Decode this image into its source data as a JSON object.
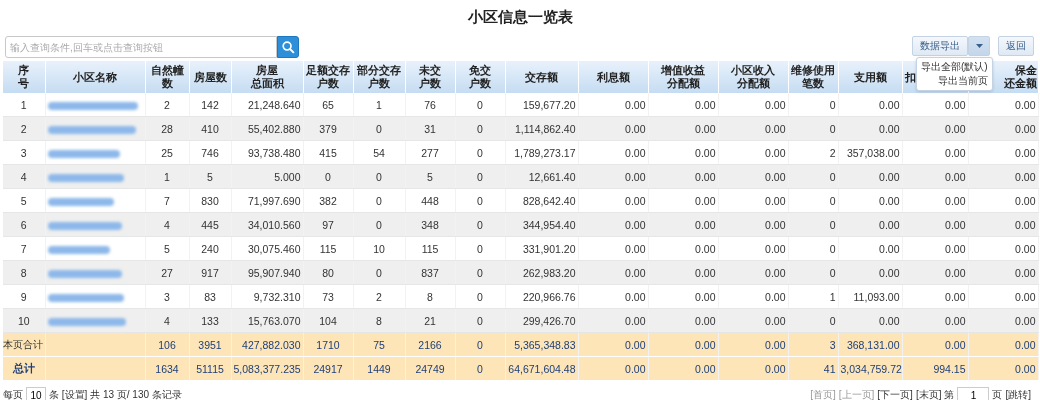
{
  "title": "小区信息一览表",
  "search": {
    "placeholder": "输入查询条件,回车或点击查询按钮"
  },
  "toolbar": {
    "export_button": "数据导出",
    "back_button": "返回"
  },
  "export_menu": {
    "expanded": true,
    "items": [
      "导出全部(默认)",
      "导出当前页"
    ]
  },
  "columns": [
    {
      "lines": [
        "序",
        "号"
      ]
    },
    {
      "lines": [
        "小区名称"
      ]
    },
    {
      "lines": [
        "自然幢",
        "数"
      ]
    },
    {
      "lines": [
        "房屋数"
      ]
    },
    {
      "lines": [
        "房屋",
        "总面积"
      ]
    },
    {
      "lines": [
        "足额交存",
        "户数"
      ]
    },
    {
      "lines": [
        "部分交存",
        "户数"
      ]
    },
    {
      "lines": [
        "未交",
        "户数"
      ]
    },
    {
      "lines": [
        "免交",
        "户数"
      ]
    },
    {
      "lines": [
        "交存额"
      ]
    },
    {
      "lines": [
        "利息额"
      ]
    },
    {
      "lines": [
        "增值收益",
        "分配额"
      ]
    },
    {
      "lines": [
        "小区收入",
        "分配额"
      ]
    },
    {
      "lines": [
        "维修使用",
        "笔数"
      ]
    },
    {
      "lines": [
        "支用额"
      ]
    },
    {
      "lines": [
        "扣"
      ]
    },
    {
      "lines": [
        "保金",
        "还金额"
      ]
    }
  ],
  "rows": [
    {
      "no": "1",
      "cells": [
        "2",
        "142",
        "21,248.640",
        "65",
        "1",
        "76",
        "0",
        "159,677.20",
        "0.00",
        "0.00",
        "0.00",
        "0",
        "0.00",
        "0.00",
        "0.00"
      ]
    },
    {
      "no": "2",
      "cells": [
        "28",
        "410",
        "55,402.880",
        "379",
        "0",
        "31",
        "0",
        "1,114,862.40",
        "0.00",
        "0.00",
        "0.00",
        "0",
        "0.00",
        "0.00",
        "0.00"
      ]
    },
    {
      "no": "3",
      "cells": [
        "25",
        "746",
        "93,738.480",
        "415",
        "54",
        "277",
        "0",
        "1,789,273.17",
        "0.00",
        "0.00",
        "0.00",
        "2",
        "357,038.00",
        "0.00",
        "0.00"
      ]
    },
    {
      "no": "4",
      "cells": [
        "1",
        "5",
        "5.000",
        "0",
        "0",
        "5",
        "0",
        "12,661.40",
        "0.00",
        "0.00",
        "0.00",
        "0",
        "0.00",
        "0.00",
        "0.00"
      ]
    },
    {
      "no": "5",
      "cells": [
        "7",
        "830",
        "71,997.690",
        "382",
        "0",
        "448",
        "0",
        "828,642.40",
        "0.00",
        "0.00",
        "0.00",
        "0",
        "0.00",
        "0.00",
        "0.00"
      ]
    },
    {
      "no": "6",
      "cells": [
        "4",
        "445",
        "34,010.560",
        "97",
        "0",
        "348",
        "0",
        "344,954.40",
        "0.00",
        "0.00",
        "0.00",
        "0",
        "0.00",
        "0.00",
        "0.00"
      ]
    },
    {
      "no": "7",
      "cells": [
        "5",
        "240",
        "30,075.460",
        "115",
        "10",
        "115",
        "0",
        "331,901.20",
        "0.00",
        "0.00",
        "0.00",
        "0",
        "0.00",
        "0.00",
        "0.00"
      ]
    },
    {
      "no": "8",
      "cells": [
        "27",
        "917",
        "95,907.940",
        "80",
        "0",
        "837",
        "0",
        "262,983.20",
        "0.00",
        "0.00",
        "0.00",
        "0",
        "0.00",
        "0.00",
        "0.00"
      ]
    },
    {
      "no": "9",
      "cells": [
        "3",
        "83",
        "9,732.310",
        "73",
        "2",
        "8",
        "0",
        "220,966.76",
        "0.00",
        "0.00",
        "0.00",
        "1",
        "11,093.00",
        "0.00",
        "0.00"
      ]
    },
    {
      "no": "10",
      "cells": [
        "4",
        "133",
        "15,763.070",
        "104",
        "8",
        "21",
        "0",
        "299,426.70",
        "0.00",
        "0.00",
        "0.00",
        "0",
        "0.00",
        "0.00",
        "0.00"
      ]
    }
  ],
  "totals": [
    {
      "kind": "page",
      "label": "本页合计",
      "cells": [
        "106",
        "3951",
        "427,882.030",
        "1710",
        "75",
        "2166",
        "0",
        "5,365,348.83",
        "0.00",
        "0.00",
        "0.00",
        "3",
        "368,131.00",
        "0.00",
        "0.00"
      ]
    },
    {
      "kind": "grand",
      "label": "总计",
      "cells": [
        "1634",
        "51115",
        "5,083,377.235",
        "24917",
        "1449",
        "24749",
        "0",
        "64,671,604.48",
        "0.00",
        "0.00",
        "0.00",
        "41",
        "3,034,759.72",
        "994.15",
        "0.00"
      ]
    }
  ],
  "pager": {
    "per_page_label": "每页",
    "per_page": "10",
    "summary": "条 [设置] 共 13 页/ 130 条记录",
    "links": [
      {
        "label": "[首页]",
        "disabled": true
      },
      {
        "label": "[上一页]",
        "disabled": true
      },
      {
        "label": "[下一页]",
        "disabled": false
      },
      {
        "label": "[末页]",
        "disabled": false
      }
    ],
    "page_prefix": "第",
    "page": "1",
    "page_suffix": "页",
    "jump": "[跳转]"
  }
}
